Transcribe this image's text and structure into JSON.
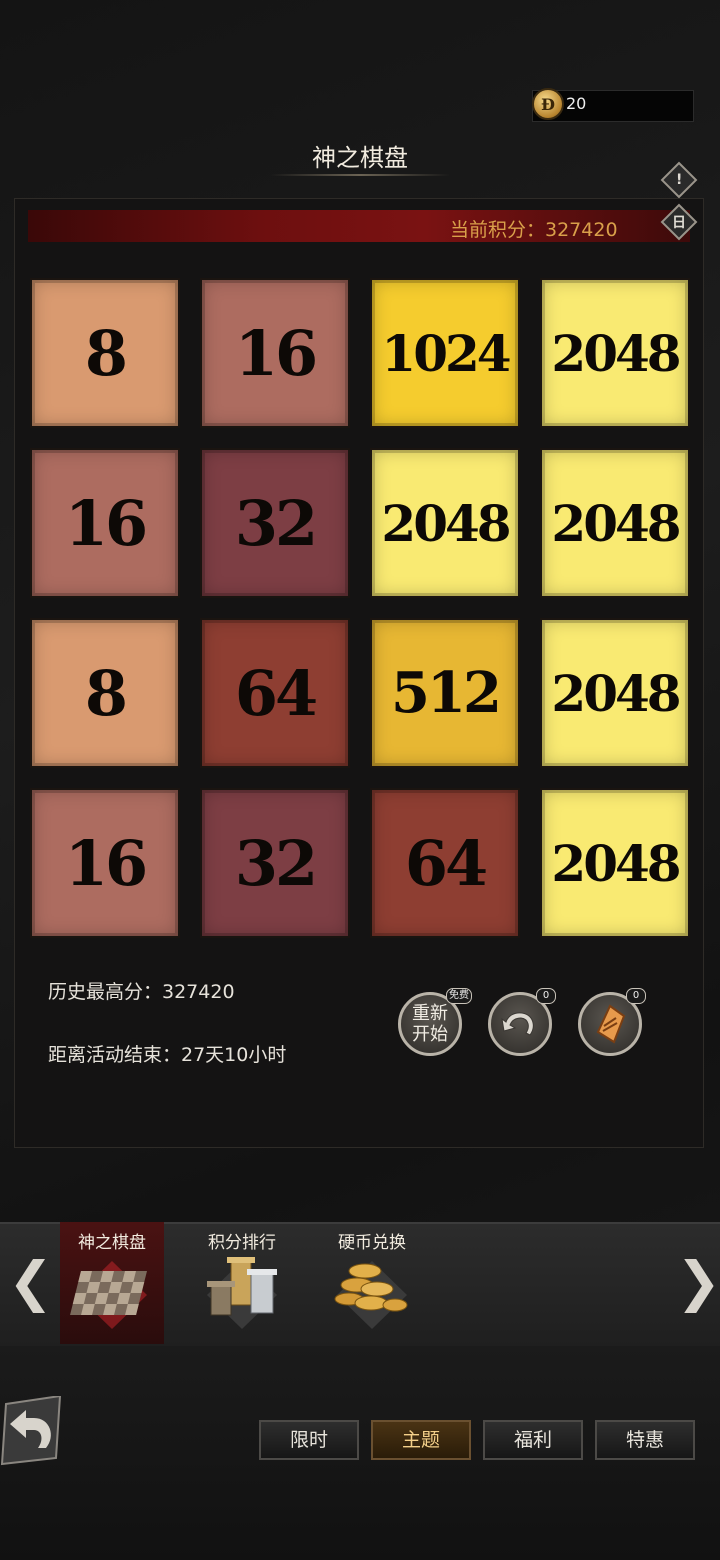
{
  "header": {
    "coin_icon_glyph": "Ɖ",
    "coins": "20",
    "title": "神之棋盘",
    "info_button_glyph": "!",
    "calendar_button_glyph": "日"
  },
  "score": {
    "label": "当前积分：327420"
  },
  "board": {
    "tiles": [
      {
        "value": "8",
        "color": "#d99a70"
      },
      {
        "value": "16",
        "color": "#ad6c60"
      },
      {
        "value": "1024",
        "color": "#f5cc2e"
      },
      {
        "value": "2048",
        "color": "#f9ea72"
      },
      {
        "value": "16",
        "color": "#ad6c60"
      },
      {
        "value": "32",
        "color": "#7d3e44"
      },
      {
        "value": "2048",
        "color": "#f9ea72"
      },
      {
        "value": "2048",
        "color": "#f9ea72"
      },
      {
        "value": "8",
        "color": "#d99a70"
      },
      {
        "value": "64",
        "color": "#8e3e32"
      },
      {
        "value": "512",
        "color": "#e7b733"
      },
      {
        "value": "2048",
        "color": "#f9ea72"
      },
      {
        "value": "16",
        "color": "#ad6c60"
      },
      {
        "value": "32",
        "color": "#7d3e44"
      },
      {
        "value": "64",
        "color": "#8e3e32"
      },
      {
        "value": "2048",
        "color": "#f9ea72"
      }
    ]
  },
  "stats": {
    "best_score": "历史最高分：327420",
    "time_left": "距离活动结束：27天10小时"
  },
  "actions": {
    "restart_line1": "重新",
    "restart_line2": "开始",
    "restart_badge": "免费",
    "undo_badge": "0",
    "card_badge": "0"
  },
  "categories": {
    "items": [
      {
        "label": "神之棋盘"
      },
      {
        "label": "积分排行"
      },
      {
        "label": "硬币兑换"
      }
    ],
    "prev_glyph": "❮",
    "next_glyph": "❯"
  },
  "footer": {
    "tabs": [
      {
        "label": "限时"
      },
      {
        "label": "主题"
      },
      {
        "label": "福利"
      },
      {
        "label": "特惠"
      }
    ]
  }
}
